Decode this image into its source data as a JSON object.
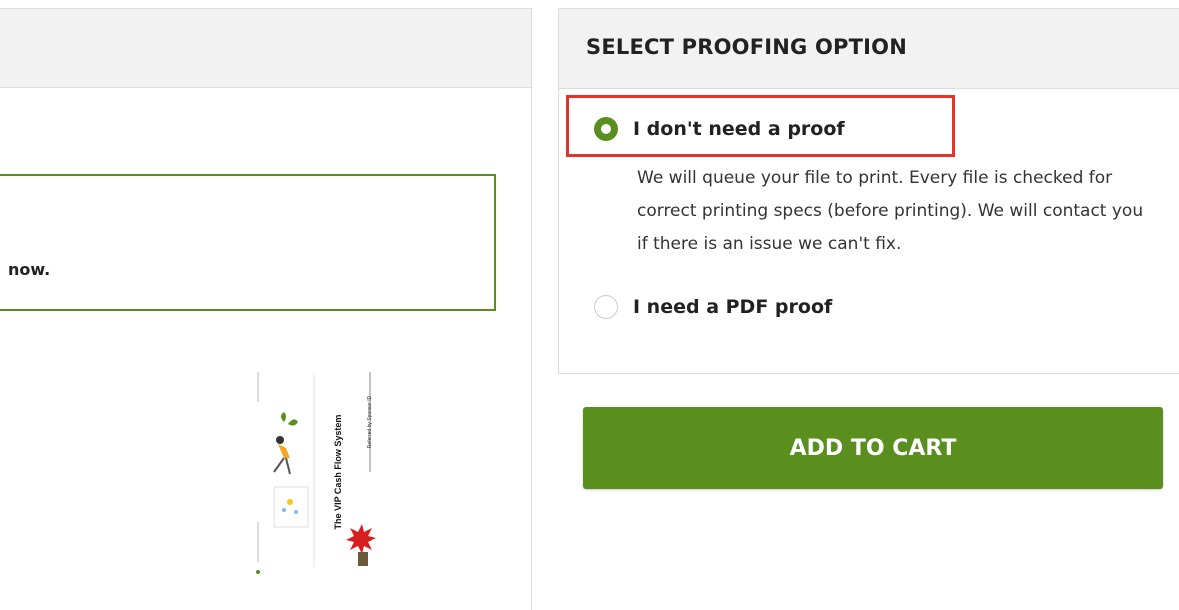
{
  "left": {
    "notice_text": "now."
  },
  "preview": {
    "title": "The VIP Cash Flow System",
    "subtitle": "Referred by Sponsor ID"
  },
  "proofing": {
    "title": "SELECT PROOFING OPTION",
    "options": [
      {
        "label": "I don't need a proof",
        "selected": true,
        "description": "We will queue your file to print. Every file is checked for correct printing specs (before printing). We will contact you if there is an issue we can't fix."
      },
      {
        "label": "I need a PDF proof",
        "selected": false
      }
    ],
    "highlight_color": "#e5332a"
  },
  "cart": {
    "button_label": "ADD TO CART"
  },
  "colors": {
    "accent": "#5a8f1f",
    "header_bg": "#f2f2f2",
    "border": "#dcdcdc"
  }
}
